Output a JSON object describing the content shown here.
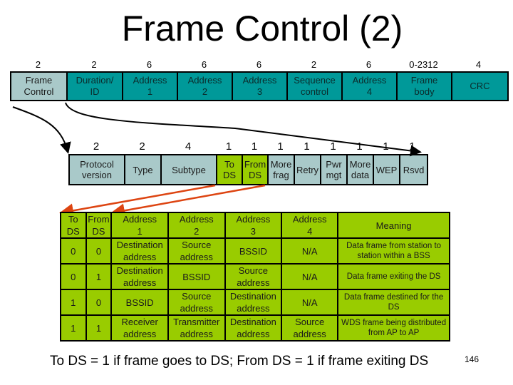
{
  "title": "Frame Control (2)",
  "mac_frame": {
    "sizes": [
      "2",
      "2",
      "6",
      "6",
      "6",
      "2",
      "6",
      "0-2312",
      "4"
    ],
    "fields": [
      {
        "label": "Frame\nControl",
        "style": "grey"
      },
      {
        "label": "Duration/\nID",
        "style": "teal"
      },
      {
        "label": "Address\n1",
        "style": "teal"
      },
      {
        "label": "Address\n2",
        "style": "teal"
      },
      {
        "label": "Address\n3",
        "style": "teal"
      },
      {
        "label": "Sequence\ncontrol",
        "style": "teal"
      },
      {
        "label": "Address\n4",
        "style": "teal"
      },
      {
        "label": "Frame\nbody",
        "style": "teal"
      },
      {
        "label": "CRC",
        "style": "teal"
      }
    ]
  },
  "frame_control": {
    "sizes": [
      "2",
      "2",
      "4",
      "1",
      "1",
      "1",
      "1",
      "1",
      "1",
      "1",
      "1"
    ],
    "fields": [
      {
        "label": "Protocol\nversion",
        "style": "grey"
      },
      {
        "label": "Type",
        "style": "grey"
      },
      {
        "label": "Subtype",
        "style": "grey"
      },
      {
        "label": "To\nDS",
        "style": "lime"
      },
      {
        "label": "From\nDS",
        "style": "lime"
      },
      {
        "label": "More\nfrag",
        "style": "grey"
      },
      {
        "label": "Retry",
        "style": "grey"
      },
      {
        "label": "Pwr\nmgt",
        "style": "grey"
      },
      {
        "label": "More\ndata",
        "style": "grey"
      },
      {
        "label": "WEP",
        "style": "grey"
      },
      {
        "label": "Rsvd",
        "style": "grey"
      }
    ]
  },
  "address_table": {
    "headers": [
      "To\nDS",
      "From\nDS",
      "Address\n1",
      "Address\n2",
      "Address\n3",
      "Address\n4",
      "Meaning"
    ],
    "rows": [
      [
        "0",
        "0",
        "Destination\naddress",
        "Source\naddress",
        "BSSID",
        "N/A",
        "Data frame from station to\nstation within a BSS"
      ],
      [
        "0",
        "1",
        "Destination\naddress",
        "BSSID",
        "Source\naddress",
        "N/A",
        "Data frame exiting the DS"
      ],
      [
        "1",
        "0",
        "BSSID",
        "Source\naddress",
        "Destination\naddress",
        "N/A",
        "Data frame destined for the\nDS"
      ],
      [
        "1",
        "1",
        "Receiver\naddress",
        "Transmitter\naddress",
        "Destination\naddress",
        "Source\naddress",
        "WDS frame being distributed\nfrom AP to AP"
      ]
    ]
  },
  "footer": "To DS = 1 if frame goes to DS;  From DS = 1 if frame exiting DS",
  "page_number": "146",
  "colors": {
    "teal": "#009999",
    "grey": "#a9c9c9",
    "lime": "#99cc00",
    "arrow_red": "#dd4411"
  }
}
